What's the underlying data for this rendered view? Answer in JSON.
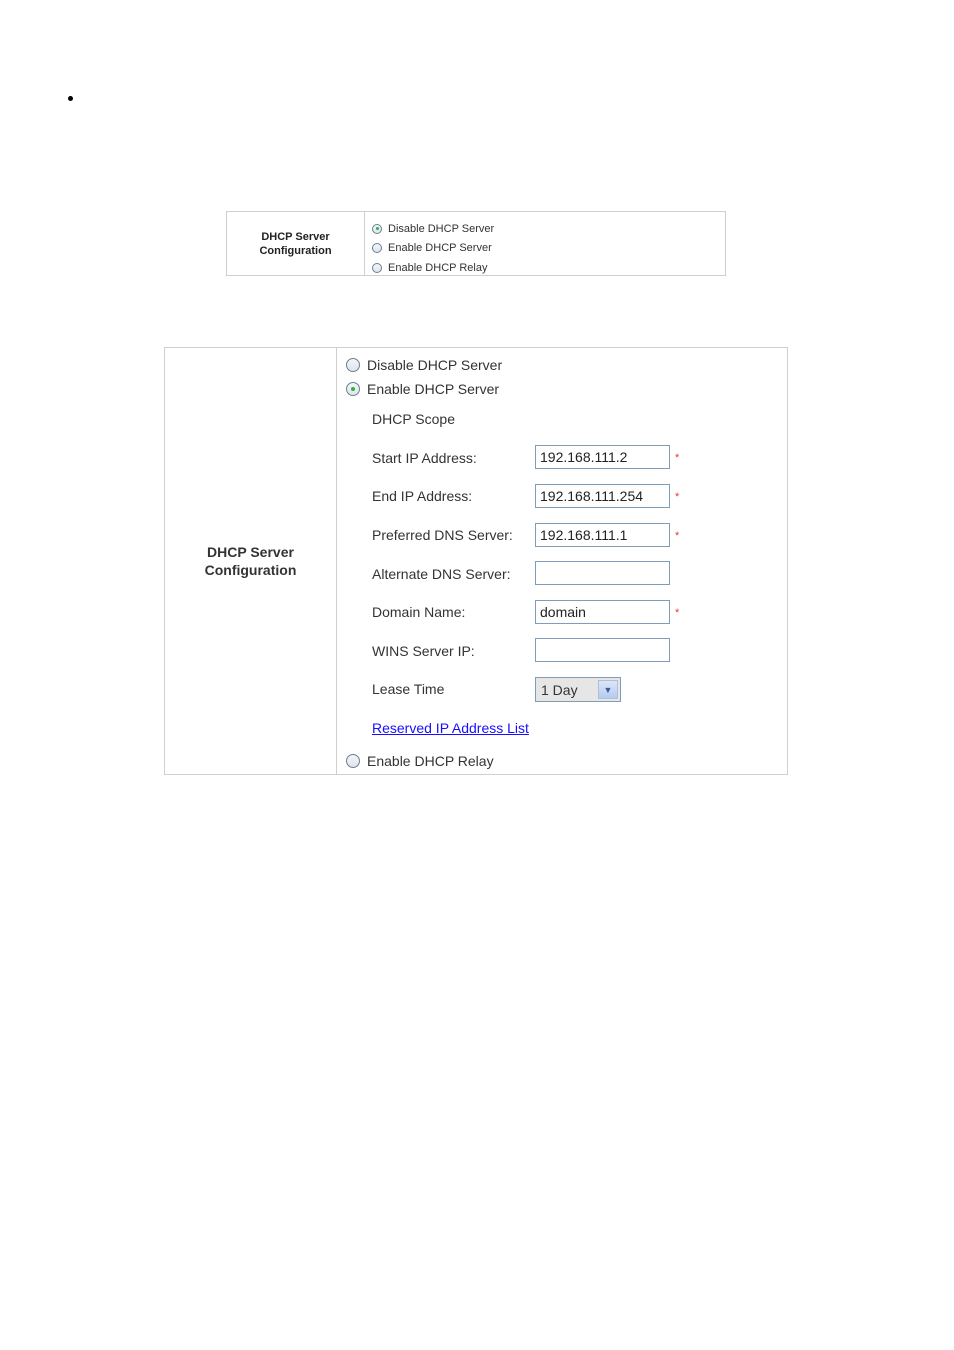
{
  "small_table": {
    "label_line1": "DHCP Server",
    "label_line2": "Configuration",
    "options": [
      {
        "label": "Disable DHCP Server",
        "selected": true
      },
      {
        "label": "Enable DHCP Server",
        "selected": false
      },
      {
        "label": "Enable DHCP Relay",
        "selected": false
      }
    ]
  },
  "large_table": {
    "label_line1": "DHCP Server",
    "label_line2": "Configuration",
    "options": [
      {
        "label": "Disable DHCP Server",
        "selected": false
      },
      {
        "label": "Enable DHCP Server",
        "selected": true
      },
      {
        "label": "Enable DHCP Relay",
        "selected": false
      }
    ],
    "scope_title": "DHCP Scope",
    "fields": [
      {
        "label": "Start IP Address:",
        "value": "192.168.111.2",
        "required": "*"
      },
      {
        "label": "End IP Address:",
        "value": "192.168.111.254",
        "required": "*"
      },
      {
        "label": "Preferred DNS Server:",
        "value": "192.168.111.1",
        "required": "*"
      },
      {
        "label": "Alternate DNS Server:",
        "value": ""
      },
      {
        "label": "Domain Name:",
        "value": "domain",
        "required": "*"
      },
      {
        "label": "WINS Server IP:",
        "value": ""
      }
    ],
    "lease_time": {
      "label": "Lease Time",
      "value": "1 Day",
      "icon": "chevron-down-icon"
    },
    "reserved_link": "Reserved IP Address List"
  }
}
